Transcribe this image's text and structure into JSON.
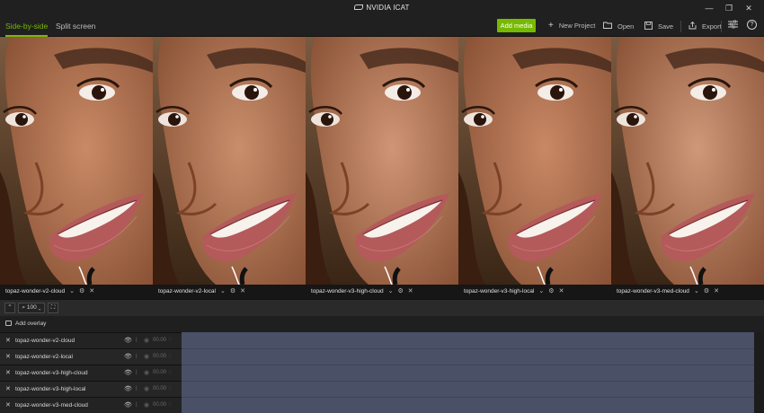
{
  "app": {
    "title": "NVIDIA ICAT"
  },
  "window_controls": [
    "—",
    "❐",
    "✕"
  ],
  "tabs": [
    {
      "label": "Side-by-side",
      "active": true
    },
    {
      "label": "Split screen",
      "active": false
    }
  ],
  "toolbar": {
    "add_media": "Add media",
    "new_project": "New Project",
    "open": "Open",
    "save": "Save",
    "export": "Export"
  },
  "panels": [
    {
      "label": "topaz-wonder-v2-cloud"
    },
    {
      "label": "topaz-wonder-v2-local"
    },
    {
      "label": "topaz-wonder-v3-high-cloud"
    },
    {
      "label": "topaz-wonder-v3-high-local"
    },
    {
      "label": "topaz-wonder-v3-med-cloud"
    }
  ],
  "controls": {
    "zoom": "100"
  },
  "overlay": {
    "label": "Add overlay"
  },
  "tracks": [
    {
      "name": "topaz-wonder-v2-cloud",
      "time": "00.00"
    },
    {
      "name": "topaz-wonder-v2-local",
      "time": "00.00"
    },
    {
      "name": "topaz-wonder-v3-high-cloud",
      "time": "00.00"
    },
    {
      "name": "topaz-wonder-v3-high-local",
      "time": "00.00"
    },
    {
      "name": "topaz-wonder-v3-med-cloud",
      "time": "00.00"
    }
  ],
  "colors": {
    "accent": "#76b900",
    "clip": "#4a5066"
  }
}
